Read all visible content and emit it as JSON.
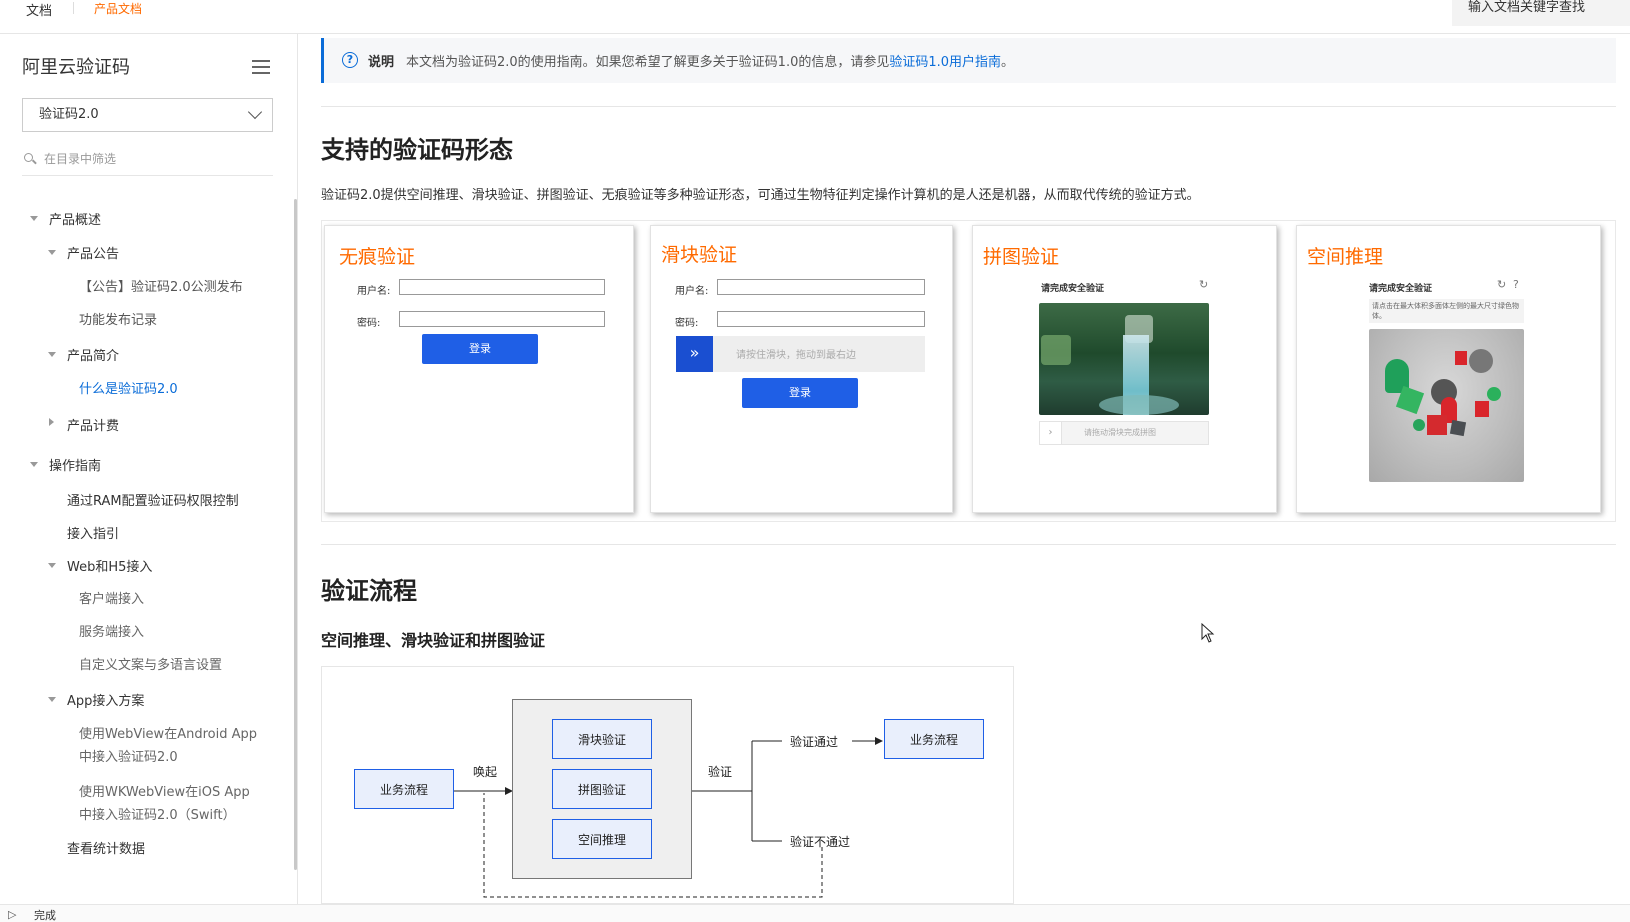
{
  "topbar": {
    "doc_label": "文档",
    "product_docs_label": "产品文档",
    "search_placeholder": "输入文档关键字查找"
  },
  "sidebar": {
    "title": "阿里云验证码",
    "version_select": "验证码2.0",
    "filter_placeholder": "在目录中筛选",
    "items": [
      {
        "label": "产品概述"
      },
      {
        "label": "产品公告"
      },
      {
        "label": "【公告】验证码2.0公测发布"
      },
      {
        "label": "功能发布记录"
      },
      {
        "label": "产品简介"
      },
      {
        "label": "什么是验证码2.0"
      },
      {
        "label": "产品计费"
      },
      {
        "label": "操作指南"
      },
      {
        "label": "通过RAM配置验证码权限控制"
      },
      {
        "label": "接入指引"
      },
      {
        "label": "Web和H5接入"
      },
      {
        "label": "客户端接入"
      },
      {
        "label": "服务端接入"
      },
      {
        "label": "自定义文案与多语言设置"
      },
      {
        "label": "App接入方案"
      },
      {
        "label": "使用WebView在Android App",
        "label2": "中接入验证码2.0"
      },
      {
        "label": "使用WKWebView在iOS App",
        "label2": "中接入验证码2.0（Swift）"
      },
      {
        "label": "查看统计数据"
      }
    ]
  },
  "notice": {
    "title": "说明",
    "text": "本文档为验证码2.0的使用指南。如果您希望了解更多关于验证码1.0的信息，请参见",
    "link": "验证码1.0用户指南",
    "tail": "。"
  },
  "section1": {
    "heading": "支持的验证码形态",
    "paragraph": "验证码2.0提供空间推理、滑块验证、拼图验证、无痕验证等多种验证形态，可通过生物特征判定操作计算机的是人还是机器，从而取代传统的验证方式。"
  },
  "cards": [
    {
      "title": "无痕验证",
      "username_label": "用户名:",
      "password_label": "密码:",
      "login_button": "登录"
    },
    {
      "title": "滑块验证",
      "username_label": "用户名:",
      "password_label": "密码:",
      "slider_hint": "请按住滑块，拖动到最右边",
      "login_button": "登录"
    },
    {
      "title": "拼图验证",
      "header": "请完成安全验证",
      "bar_hint": "请拖动滑块完成拼图"
    },
    {
      "title": "空间推理",
      "header": "请完成安全验证",
      "instruction": "请点击在最大体积多面体左侧的最大尺寸绿色物体。"
    }
  ],
  "section2": {
    "heading": "验证流程",
    "subheading": "空间推理、滑块验证和拼图验证"
  },
  "flow": {
    "start_box": "业务流程",
    "invoke_label": "唤起",
    "methods": [
      "滑块验证",
      "拼图验证",
      "空间推理"
    ],
    "verify_label": "验证",
    "pass_label": "验证通过",
    "fail_label": "验证不通过",
    "end_box": "业务流程"
  },
  "statusbar": {
    "text": "完成"
  },
  "colors": {
    "accent_orange": "#ff6a00",
    "link_blue": "#0a6cd8",
    "button_blue": "#1f5fe6"
  }
}
